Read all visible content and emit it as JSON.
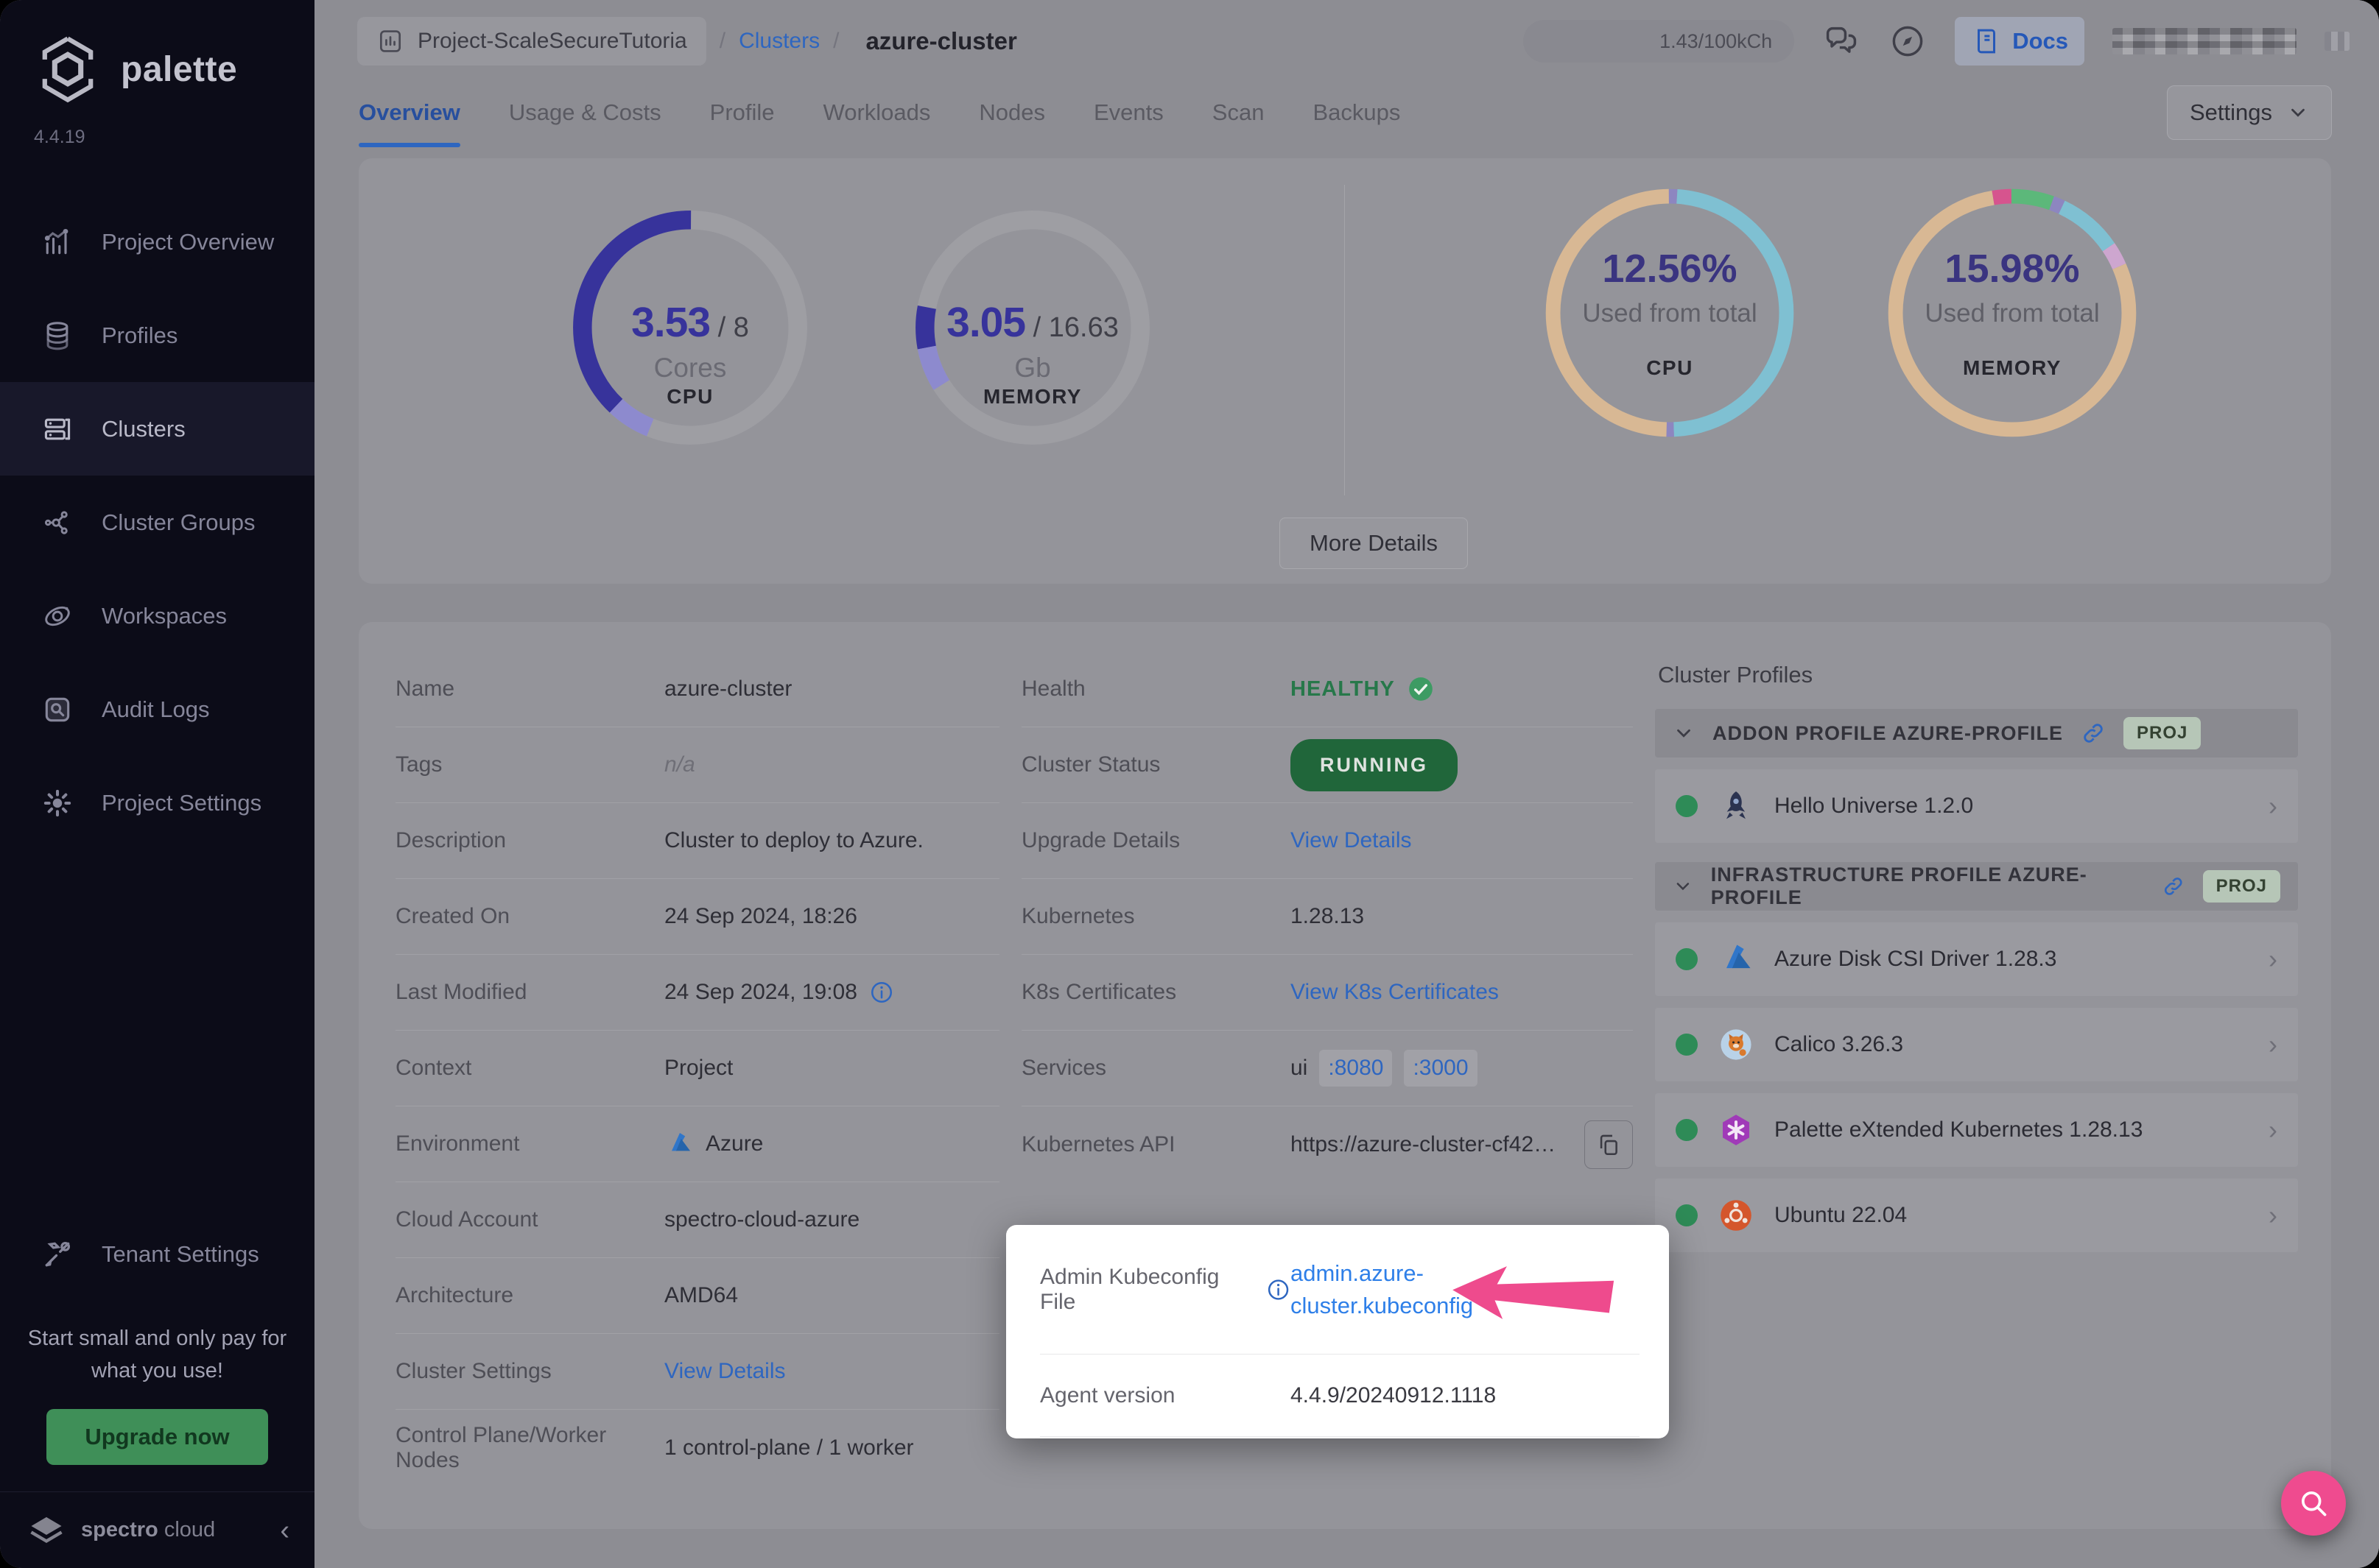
{
  "brand": {
    "name": "palette",
    "version": "4.4.19",
    "footer_name": "spectro",
    "footer_suffix": "cloud"
  },
  "sidebar": {
    "items": [
      {
        "label": "Project Overview",
        "icon": "chart",
        "active": false
      },
      {
        "label": "Profiles",
        "icon": "layers",
        "active": false
      },
      {
        "label": "Clusters",
        "icon": "servers",
        "active": true
      },
      {
        "label": "Cluster Groups",
        "icon": "network",
        "active": false
      },
      {
        "label": "Workspaces",
        "icon": "orbit",
        "active": false
      },
      {
        "label": "Audit Logs",
        "icon": "audit",
        "active": false
      },
      {
        "label": "Project Settings",
        "icon": "gear",
        "active": false
      }
    ],
    "tenant": {
      "label": "Tenant Settings",
      "icon": "tools"
    },
    "promo": {
      "text": "Start small and only pay for what you use!",
      "button": "Upgrade now"
    }
  },
  "header": {
    "project": "Project-ScaleSecureTutoria",
    "breadcrumb_link": "Clusters",
    "breadcrumb_current": "azure-cluster",
    "usage_pill": "1.43/100kCh",
    "docs_label": "Docs"
  },
  "tabs": {
    "items": [
      "Overview",
      "Usage & Costs",
      "Profile",
      "Workloads",
      "Nodes",
      "Events",
      "Scan",
      "Backups"
    ],
    "active": "Overview",
    "settings_label": "Settings"
  },
  "overview": {
    "gauges": [
      {
        "value": "3.53",
        "total": " / 8",
        "unit": "Cores",
        "label": "CPU",
        "segments": [
          {
            "from": 0,
            "to": 38,
            "color": "#37339b"
          },
          {
            "from": 38,
            "to": 44,
            "color": "#8d8ace"
          }
        ]
      },
      {
        "value": "3.05",
        "total": " / 16.63",
        "unit": "Gb",
        "label": "MEMORY",
        "segments": [
          {
            "from": 22,
            "to": 28,
            "color": "#37339b"
          },
          {
            "from": 28,
            "to": 34,
            "color": "#8d8ace"
          }
        ]
      }
    ],
    "donuts": [
      {
        "percent": "12.56%",
        "caption": "Used from total",
        "label": "CPU",
        "segments": [
          {
            "color": "#8d86c0",
            "size": 1
          },
          {
            "color": "#7fc0d2",
            "size": 48.5
          },
          {
            "color": "#8d86c0",
            "size": 1
          },
          {
            "color": "#d8b894",
            "size": 49.5
          }
        ]
      },
      {
        "percent": "15.98%",
        "caption": "Used from total",
        "label": "MEMORY",
        "segments": [
          {
            "color": "#5cb87a",
            "size": 5.5
          },
          {
            "color": "#8d86c0",
            "size": 1.5
          },
          {
            "color": "#7fc0d2",
            "size": 8.5
          },
          {
            "color": "#cda6cf",
            "size": 3
          },
          {
            "color": "#d8b894",
            "size": 79
          },
          {
            "color": "#d6548e",
            "size": 2.5
          }
        ]
      }
    ],
    "more_details": "More Details"
  },
  "details_left": [
    {
      "label": "Name",
      "value": "azure-cluster",
      "type": "text"
    },
    {
      "label": "Tags",
      "value": "n/a",
      "type": "muted"
    },
    {
      "label": "Description",
      "value": "Cluster to deploy to Azure.",
      "type": "text"
    },
    {
      "label": "Created On",
      "value": "24 Sep 2024, 18:26",
      "type": "text"
    },
    {
      "label": "Last Modified",
      "value": "24 Sep 2024, 19:08",
      "type": "info"
    },
    {
      "label": "Context",
      "value": "Project",
      "type": "text"
    },
    {
      "label": "Environment",
      "value": "Azure",
      "type": "azure"
    },
    {
      "label": "Cloud Account",
      "value": "spectro-cloud-azure",
      "type": "text"
    },
    {
      "label": "Architecture",
      "value": "AMD64",
      "type": "text"
    },
    {
      "label": "Cluster Settings",
      "value": "View Details",
      "type": "link"
    },
    {
      "label": "Control Plane/Worker Nodes",
      "value": "1 control-plane / 1 worker",
      "type": "text"
    }
  ],
  "details_mid": [
    {
      "label": "Health",
      "value": "HEALTHY",
      "type": "health"
    },
    {
      "label": "Cluster Status",
      "value": "RUNNING",
      "type": "status"
    },
    {
      "label": "Upgrade Details",
      "value": "View Details",
      "type": "link"
    },
    {
      "label": "Kubernetes",
      "value": "1.28.13",
      "type": "text"
    },
    {
      "label": "K8s Certificates",
      "value": "View K8s Certificates",
      "type": "link"
    },
    {
      "label": "Services",
      "value": "ui",
      "ports": [
        ":8080",
        ":3000"
      ],
      "type": "ports"
    },
    {
      "label": "Kubernetes API",
      "value": "https://azure-cluster-cf42…",
      "type": "api"
    }
  ],
  "spotlight": {
    "kubeconfig_label": "Admin Kubeconfig File",
    "kubeconfig_value": "admin.azure-cluster.kubeconfig",
    "agent_label": "Agent version",
    "agent_value": "4.4.9/20240912.1118"
  },
  "cluster_profiles": {
    "heading": "Cluster Profiles",
    "sections": [
      {
        "title": "ADDON PROFILE AZURE-PROFILE",
        "badge": "PROJ",
        "items": [
          {
            "name": "Hello Universe 1.2.0",
            "icon": "hello-universe"
          }
        ]
      },
      {
        "title": "INFRASTRUCTURE PROFILE AZURE-PROFILE",
        "badge": "PROJ",
        "items": [
          {
            "name": "Azure Disk CSI Driver 1.28.3",
            "icon": "azure"
          },
          {
            "name": "Calico 3.26.3",
            "icon": "calico"
          },
          {
            "name": "Palette eXtended Kubernetes 1.28.13",
            "icon": "pxk"
          },
          {
            "name": "Ubuntu 22.04",
            "icon": "ubuntu"
          }
        ]
      }
    ]
  },
  "colors": {
    "accent_blue": "#2e66c0",
    "gauge_indigo": "#37339b",
    "health_green": "#27784a",
    "status_green": "#20663a",
    "highlight_pink": "#ee4b8d",
    "upgrade_green": "#3f8f58"
  }
}
